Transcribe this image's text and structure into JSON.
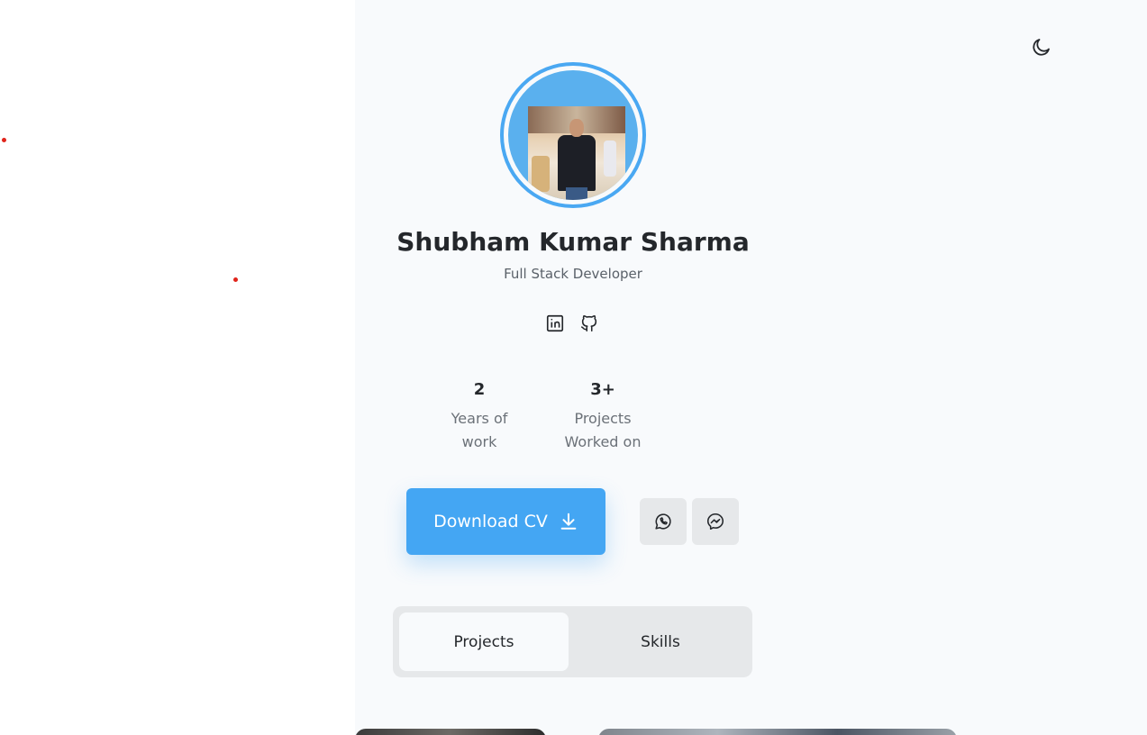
{
  "profile": {
    "name": "Shubham Kumar Sharma",
    "role": "Full Stack Developer"
  },
  "stats": [
    {
      "value": "2",
      "label": "Years of work"
    },
    {
      "value": "3+",
      "label": "Projects Worked on"
    }
  ],
  "actions": {
    "download_cv_label": "Download CV"
  },
  "tabs": [
    {
      "label": "Projects",
      "active": true
    },
    {
      "label": "Skills",
      "active": false
    }
  ],
  "icons": {
    "theme": "moon-icon",
    "social": [
      "linkedin-icon",
      "github-icon"
    ],
    "contact": [
      "whatsapp-icon",
      "messenger-icon"
    ],
    "download": "download-icon"
  },
  "colors": {
    "accent": "#44a6f3",
    "page_bg": "#f8fafc",
    "tab_bg": "#e6e8ea"
  }
}
